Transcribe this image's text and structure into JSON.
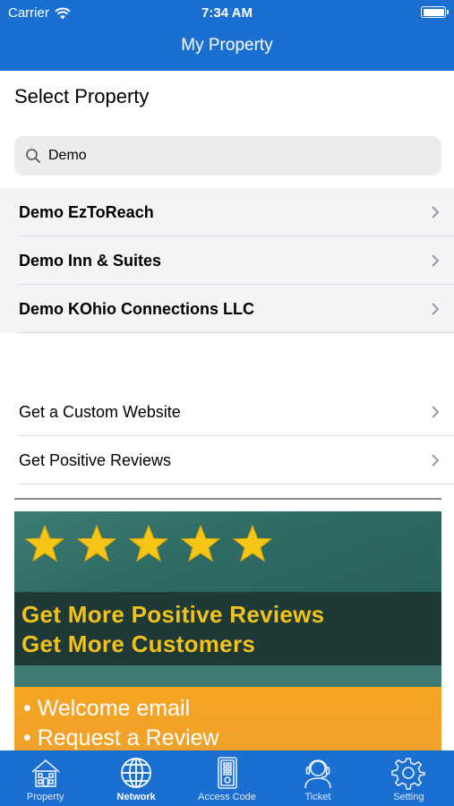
{
  "status_bar": {
    "carrier": "Carrier",
    "time": "7:34 AM"
  },
  "nav": {
    "title": "My Property"
  },
  "section": {
    "title": "Select Property"
  },
  "search": {
    "value": "Demo",
    "placeholder": "Search"
  },
  "results": [
    {
      "label": "Demo EzToReach"
    },
    {
      "label": "Demo Inn & Suites"
    },
    {
      "label": "Demo KOhio Connections LLC"
    }
  ],
  "links": [
    {
      "label": "Get a Custom Website"
    },
    {
      "label": "Get Positive Reviews"
    }
  ],
  "banner": {
    "line1": "Get More Positive Reviews",
    "line2": "Get More Customers",
    "bullet1": "• Welcome email",
    "bullet2": "• Request a Review",
    "rating_stars": 5
  },
  "tabs": [
    {
      "label": "Property",
      "icon": "property-icon"
    },
    {
      "label": "Network",
      "icon": "network-icon",
      "active": true
    },
    {
      "label": "Access Code",
      "icon": "access-code-icon"
    },
    {
      "label": "Ticket",
      "icon": "ticket-icon"
    },
    {
      "label": "Setting",
      "icon": "setting-icon"
    }
  ],
  "colors": {
    "primary": "#1a6fd1",
    "star": "#f5c518",
    "banner_text": "#f1c21b",
    "banner_orange": "#f5a623"
  }
}
